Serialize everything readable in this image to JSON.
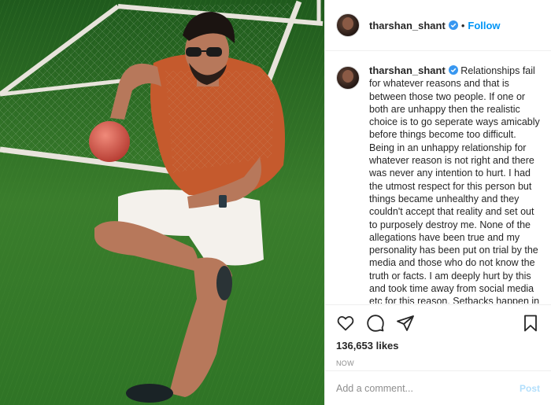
{
  "post": {
    "username": "tharshan_shant",
    "follow_label": "Follow",
    "separator": "•",
    "caption": "Relationships fail for whatever reasons and that is between those two people. If one or both are unhappy then the realistic choice is to go seperate ways amicably before things become too difficult. Being in an unhappy relationship for whatever reason is not right and there was never any intention to hurt. I had the utmost respect for this person but things became unhealthy and they couldn't accept that reality and set out to purposely destroy me. None of the allegations have been true and my personality has been put on trial by the media and those who do not know the truth or facts. I am deeply hurt by this and took time away from social media etc for this reason. Setbacks happen in life but I",
    "likes": "136,653 likes",
    "time": "NOW"
  },
  "comment_box": {
    "placeholder": "Add a comment...",
    "post_label": "Post"
  },
  "icons": {
    "like": "heart-icon",
    "comment": "comment-icon",
    "share": "share-icon",
    "save": "bookmark-icon",
    "verified": "verified-badge-icon"
  },
  "colors": {
    "link": "#0095f6",
    "post_disabled": "#b2dffc",
    "verified": "#3897f0"
  }
}
